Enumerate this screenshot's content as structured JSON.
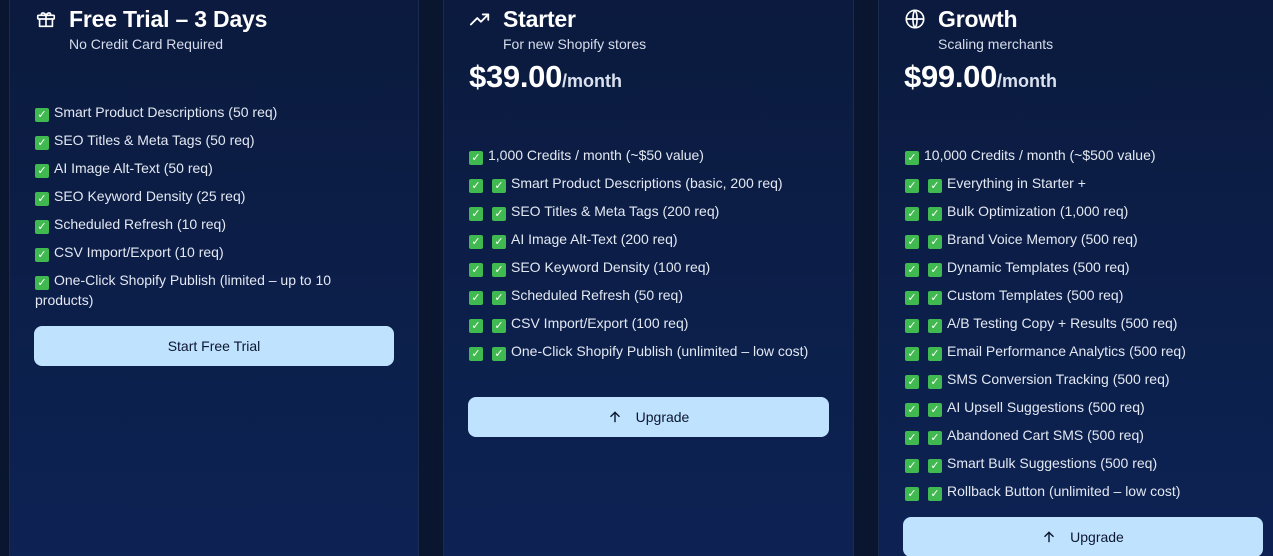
{
  "plans": [
    {
      "title": "Free Trial – 3 Days",
      "subtitle": "No Credit Card Required",
      "icon": "gift-icon",
      "features": [
        "Smart Product Descriptions (50 req)",
        "SEO Titles & Meta Tags (50 req)",
        "AI Image Alt-Text (50 req)",
        "SEO Keyword Density (25 req)",
        "Scheduled Refresh (10 req)",
        "CSV Import/Export (10 req)",
        "One-Click Shopify Publish (limited – up to 10 products)"
      ],
      "button_label": "Start Free Trial"
    },
    {
      "title": "Starter",
      "subtitle": "For new Shopify stores",
      "icon": "trending-up-icon",
      "price": "$39.00",
      "period": "/month",
      "features": [
        "1,000 Credits / month (~$50 value)",
        "Smart Product Descriptions (basic, 200 req)",
        "SEO Titles & Meta Tags (200 req)",
        "AI Image Alt-Text (200 req)",
        "SEO Keyword Density (100 req)",
        "Scheduled Refresh (50 req)",
        "CSV Import/Export (100 req)",
        "One-Click Shopify Publish (unlimited – low cost)"
      ],
      "button_label": "Upgrade"
    },
    {
      "title": "Growth",
      "subtitle": "Scaling merchants",
      "icon": "globe-icon",
      "price": "$99.00",
      "period": "/month",
      "features": [
        "10,000 Credits / month (~$500 value)",
        "Everything in Starter +",
        "Bulk Optimization (1,000 req)",
        "Brand Voice Memory (500 req)",
        "Dynamic Templates (500 req)",
        "Custom Templates (500 req)",
        "A/B Testing Copy + Results (500 req)",
        "Email Performance Analytics (500 req)",
        "SMS Conversion Tracking (500 req)",
        "AI Upsell Suggestions (500 req)",
        "Abandoned Cart SMS (500 req)",
        "Smart Bulk Suggestions (500 req)",
        "Rollback Button (unlimited – low cost)"
      ],
      "button_label": "Upgrade"
    }
  ],
  "colors": {
    "background": "#0a1530",
    "card": "#0c1f4a",
    "check": "#3fb950",
    "button": "#bfe3ff",
    "button_text": "#0c1630"
  }
}
